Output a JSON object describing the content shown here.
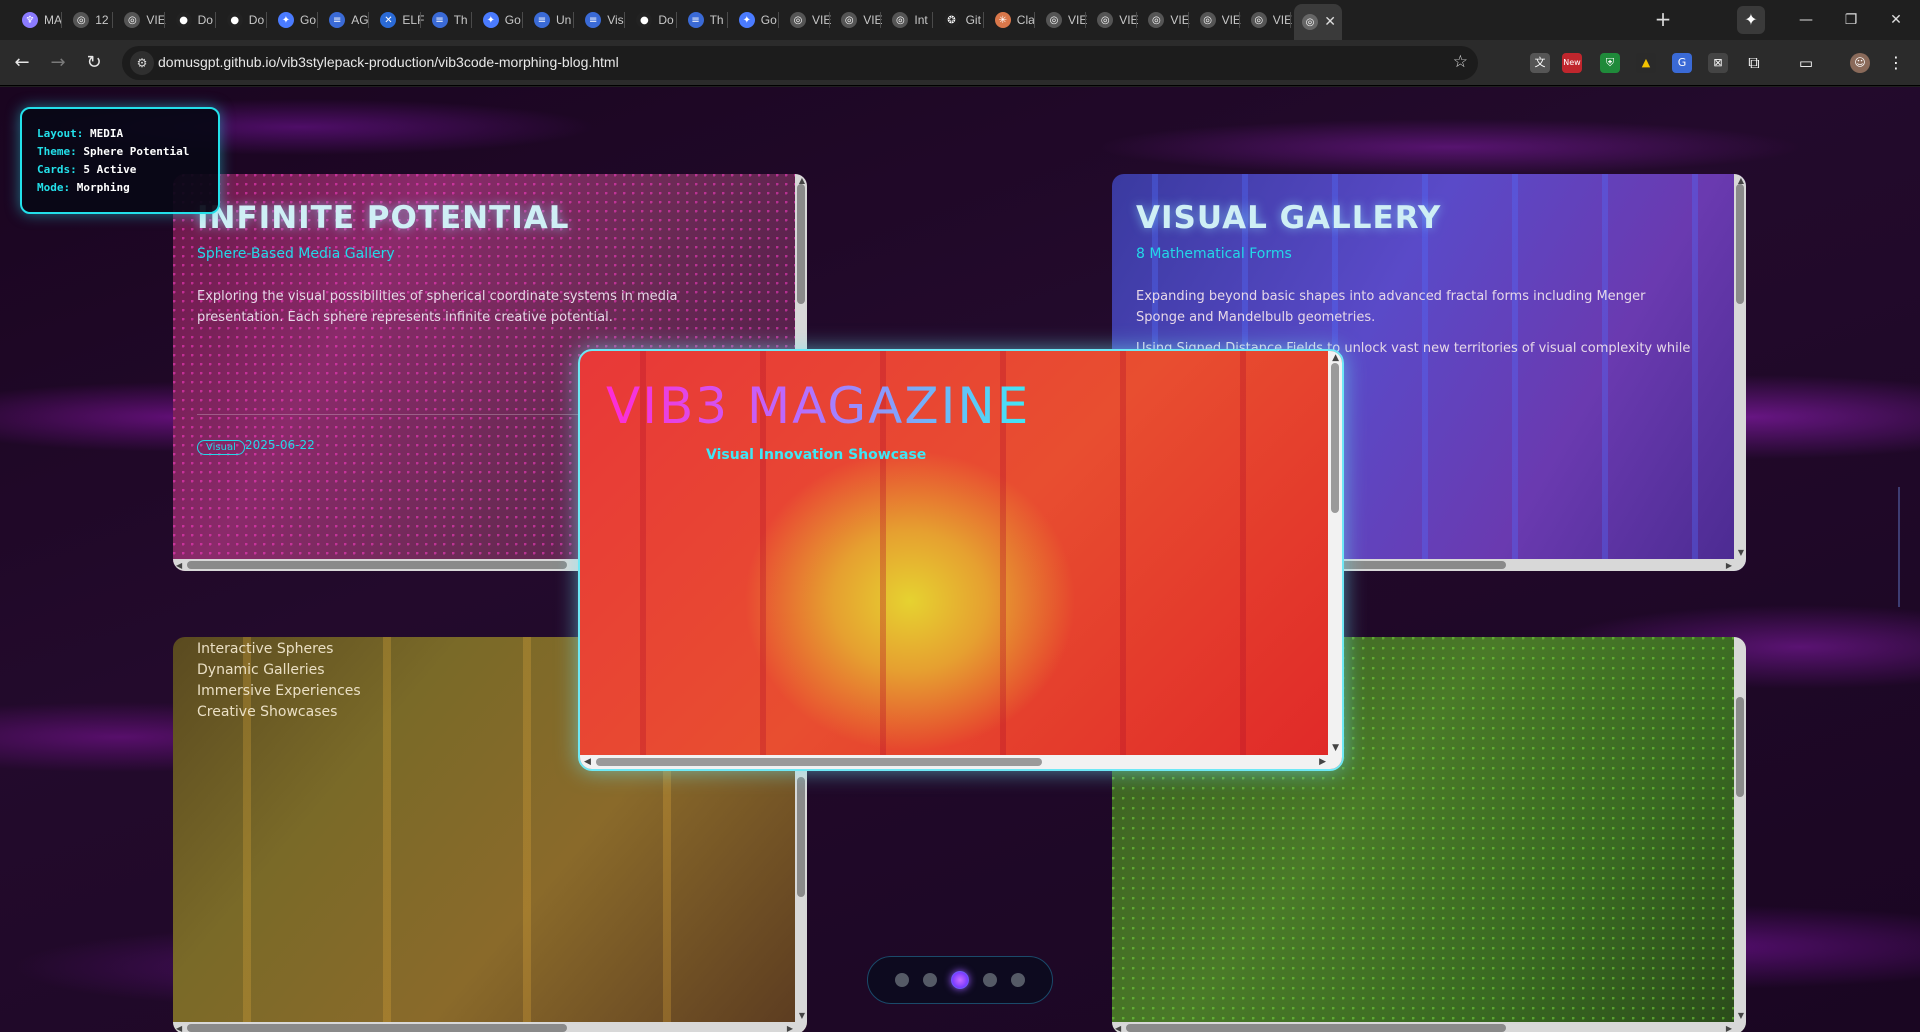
{
  "browser": {
    "tabs": [
      {
        "icon": "octopus-icon",
        "label": "MA",
        "color": "#8b7bff"
      },
      {
        "icon": "globe-icon",
        "label": "12",
        "color": "#555555"
      },
      {
        "icon": "globe-icon",
        "label": "VIE",
        "color": "#555555"
      },
      {
        "icon": "github-icon",
        "label": "Do",
        "color": "#222222"
      },
      {
        "icon": "github-icon",
        "label": "Do",
        "color": "#222222"
      },
      {
        "icon": "gemini-icon",
        "label": "Go",
        "color": "#4a7bff"
      },
      {
        "icon": "doc-icon",
        "label": "AG",
        "color": "#3a6ad6"
      },
      {
        "icon": "butterfly-icon",
        "label": "ELF",
        "color": "#2a6ad6"
      },
      {
        "icon": "doc-icon",
        "label": "Th",
        "color": "#3a6ad6"
      },
      {
        "icon": "gemini-icon",
        "label": "Go",
        "color": "#4a7bff"
      },
      {
        "icon": "doc-icon",
        "label": "Un",
        "color": "#3a6ad6"
      },
      {
        "icon": "doc-icon",
        "label": "Vis",
        "color": "#3a6ad6"
      },
      {
        "icon": "github-icon",
        "label": "Do",
        "color": "#222222"
      },
      {
        "icon": "doc-icon",
        "label": "Th",
        "color": "#3a6ad6"
      },
      {
        "icon": "gemini-icon",
        "label": "Go",
        "color": "#4a7bff"
      },
      {
        "icon": "globe-icon",
        "label": "VIE",
        "color": "#555555"
      },
      {
        "icon": "globe-icon",
        "label": "VIE",
        "color": "#555555"
      },
      {
        "icon": "globe-icon",
        "label": "Int",
        "color": "#555555"
      },
      {
        "icon": "openai-icon",
        "label": "Git",
        "color": "#222222"
      },
      {
        "icon": "claude-icon",
        "label": "Cla",
        "color": "#d9774a"
      },
      {
        "icon": "globe-icon",
        "label": "VIE",
        "color": "#555555"
      },
      {
        "icon": "globe-icon",
        "label": "VIE",
        "color": "#555555"
      },
      {
        "icon": "globe-icon",
        "label": "VIE",
        "color": "#555555"
      },
      {
        "icon": "globe-icon",
        "label": "VIE",
        "color": "#555555"
      },
      {
        "icon": "globe-icon",
        "label": "VIE",
        "color": "#555555"
      }
    ],
    "active_tab_icon": "globe-icon",
    "new_tab": "+",
    "url": "domusgpt.github.io/vib3stylepack-production/vib3code-morphing-blog.html",
    "ext_new_badge": "New"
  },
  "info_panel": {
    "layout_key": "Layout:",
    "layout_val": "MEDIA",
    "theme_key": "Theme:",
    "theme_val": "Sphere Potential",
    "cards_key": "Cards:",
    "cards_val": "5 Active",
    "mode_key": "Mode:",
    "mode_val": "Morphing"
  },
  "cards": {
    "top_left": {
      "title": "INFINITE POTENTIAL",
      "subtitle": "Sphere-Based Media Gallery",
      "body": "Exploring the visual possibilities of spherical coordinate systems in media presentation. Each sphere represents infinite creative potential.",
      "tag": "Visual",
      "date": "2025-06-22"
    },
    "top_right": {
      "title": "VISUAL GALLERY",
      "subtitle": "8 Mathematical Forms",
      "body1": "Expanding beyond basic shapes into advanced fractal forms including Menger Sponge and Mandelbulb geometries.",
      "body2": "Using Signed Distance Fields to unlock vast new territories of visual complexity while maintaining performance."
    },
    "bottom_left": {
      "items": [
        "Interactive Spheres",
        "Dynamic Galleries",
        "Immersive Experiences",
        "Creative Showcases"
      ]
    }
  },
  "feature": {
    "title": "VIB3 MAGAZINE",
    "subtitle": "Visual Innovation Showcase"
  },
  "pagination": {
    "count": 5,
    "active_index": 2
  },
  "colors": {
    "accent": "#23e0ea",
    "magenta": "#ff2bd6",
    "purple": "#7a3cff"
  }
}
